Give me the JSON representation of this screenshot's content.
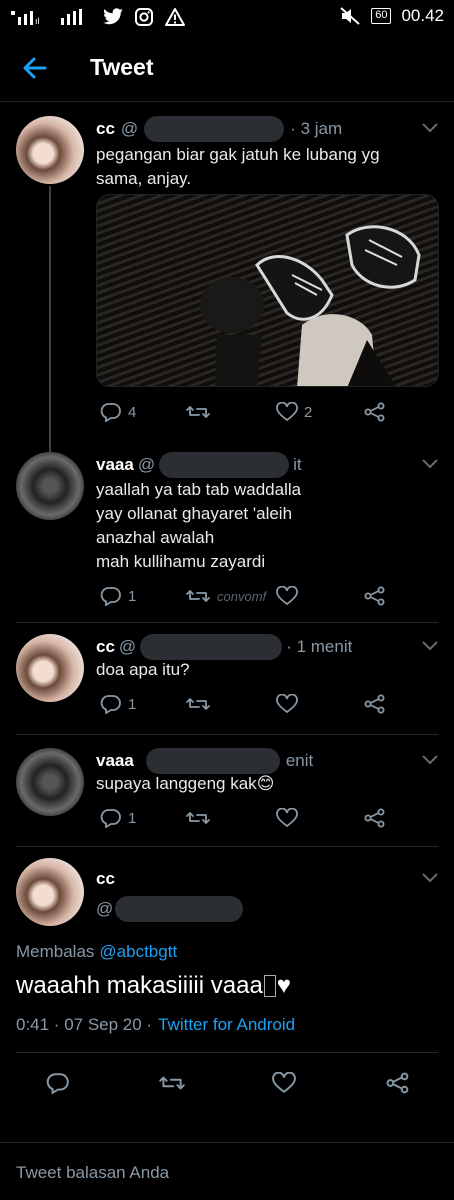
{
  "status_bar": {
    "clock": "00.42",
    "battery": "60",
    "icons": [
      "signal-icon",
      "signal-icon",
      "twitter-bird-icon",
      "instagram-icon",
      "warning-icon",
      "mute-icon"
    ]
  },
  "header": {
    "title": "Tweet"
  },
  "tweets": [
    {
      "name": "cc",
      "handle": "@",
      "time": "· 3 jam",
      "text_lines": [
        "pegangan biar gak jatuh ke lubang yg",
        "sama, anjay."
      ],
      "reply_count": "4",
      "like_count": "2"
    },
    {
      "name": "vaaa",
      "handle": "@",
      "time": "it",
      "text_lines": [
        "yaallah ya tab tab waddalla",
        "yay ollanat ghayaret 'aleih",
        "anazhal awalah",
        "mah kullihamu zayardi"
      ],
      "reply_count": "1",
      "watermark": "convomf"
    },
    {
      "name": "cc",
      "handle": "@",
      "time": "· 1 menit",
      "text_lines": [
        "doa apa itu?"
      ],
      "reply_count": "1"
    },
    {
      "name": "vaaa",
      "handle": "",
      "time": "enit",
      "text_lines": [
        "supaya langgeng kak"
      ],
      "emoji": "😊",
      "reply_count": "1"
    }
  ],
  "main_tweet": {
    "name": "cc",
    "handle": "@",
    "replying_label": "Membalas",
    "replying_to": "@abctbgtt",
    "text": "waaahh makasiiiii vaaa",
    "text_suffix": "♥",
    "time": "0:41 · 07 Sep 20 ·",
    "source": "Twitter for Android"
  },
  "reply_box": {
    "placeholder": "Tweet balasan Anda"
  },
  "colors": {
    "accent": "#1da1f2",
    "muted": "#8899a6",
    "background": "#000000"
  }
}
